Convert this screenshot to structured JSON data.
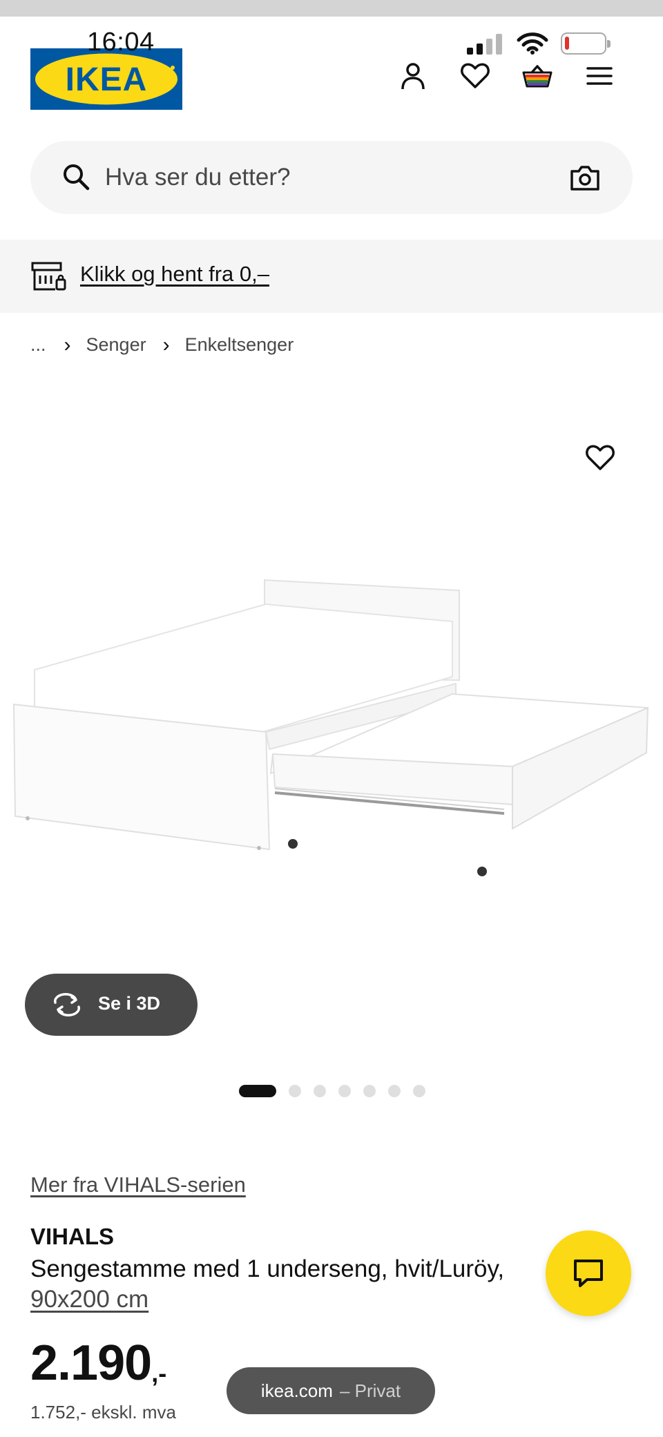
{
  "status_bar": {
    "time": "16:04",
    "signal_bars_active": 2,
    "signal_bars_total": 4,
    "battery_level": 0.1,
    "battery_color": "#e0312b"
  },
  "header": {
    "logo_text": "IKEA",
    "icons": [
      "profile-icon",
      "heart-icon",
      "basket-icon",
      "menu-icon"
    ]
  },
  "search": {
    "placeholder": "Hva ser du etter?"
  },
  "promo": {
    "text": "Klikk og hent fra 0,–"
  },
  "breadcrumb": {
    "ellipsis": "...",
    "items": [
      "Senger",
      "Enkeltsenger"
    ]
  },
  "gallery": {
    "view_3d_label": "Se i 3D",
    "image_count": 7,
    "active_index": 0
  },
  "product": {
    "series_link": "Mer fra VIHALS-serien",
    "name": "VIHALS",
    "description": "Sengestamme med 1 underseng, hvit/Luröy,",
    "size": "90x200 cm",
    "price_integer": "2.190",
    "price_suffix": ",-",
    "price_ex_vat": "1.752,- ekskl. mva"
  },
  "browser": {
    "domain": "ikea.com",
    "mode": "– Privat"
  },
  "colors": {
    "ikea_blue": "#0058a3",
    "ikea_yellow": "#fbd914",
    "dark_grey": "#484848",
    "light_grey": "#f5f5f5"
  }
}
